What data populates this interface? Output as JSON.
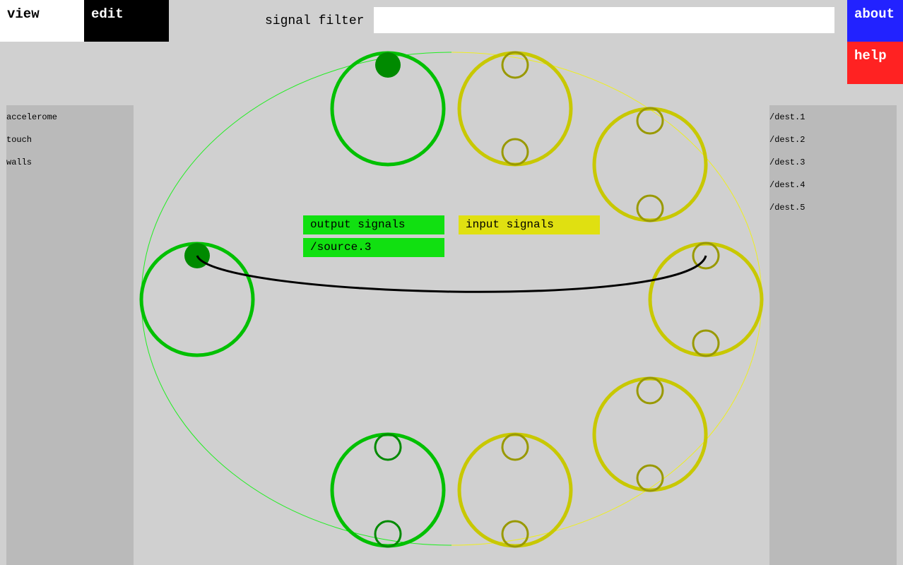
{
  "top": {
    "view_label": "view",
    "edit_label": "edit",
    "about_label": "about",
    "help_label": "help"
  },
  "filter": {
    "label": "signal filter",
    "value": "",
    "placeholder": ""
  },
  "sources": [
    "accelerome",
    "touch",
    "walls"
  ],
  "destinations": [
    "/dest.1",
    "/dest.2",
    "/dest.3",
    "/dest.4",
    "/dest.5"
  ],
  "legend": {
    "output_label": "output signals",
    "selected_output": "/source.3",
    "input_label": "input signals"
  },
  "colors": {
    "view_bg": "#ffffff",
    "edit_bg": "#000000",
    "about_bg": "#2222ff",
    "help_bg": "#ff2222",
    "source_green": "#00c000",
    "source_port_green": "#008a00",
    "dest_yellow": "#c8c800",
    "dest_port_olive": "#999900",
    "connection": "#000000"
  }
}
